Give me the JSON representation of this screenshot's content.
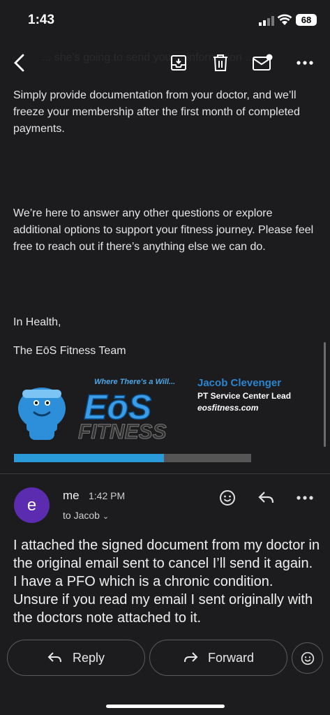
{
  "status": {
    "time": "1:43",
    "battery": "68"
  },
  "ghost_text": "... she's going to send you ... information ...",
  "email": {
    "para1": "Simply provide documentation from your doctor, and we’ll freeze your membership after the first month of completed payments.",
    "para2": "We’re here to answer any other questions or explore additional options to support your fitness journey. Please feel free to reach out if there’s anything else we can do.",
    "closing": "In Health,",
    "team": "The EōS Fitness Team",
    "signature": {
      "tagline": "Where There's a Will...",
      "logo_top": "EōS",
      "logo_bottom": "FITNESS",
      "name": "Jacob Clevenger",
      "title": "PT Service Center Lead",
      "website": "eosfitness.com"
    }
  },
  "reply": {
    "avatar_letter": "e",
    "from": "me",
    "time": "1:42 PM",
    "to": "to Jacob",
    "body": "I attached the signed document from my doctor in the original email sent to cancel I’ll send it again. I have a PFO which is a chronic condition. Unsure if you read my email I sent originally with the doctors note attached to it."
  },
  "actions": {
    "reply_label": "Reply",
    "forward_label": "Forward"
  },
  "colors": {
    "background": "#1c1c1e",
    "accent": "#2a86cf",
    "avatar": "#5b2bb0"
  }
}
